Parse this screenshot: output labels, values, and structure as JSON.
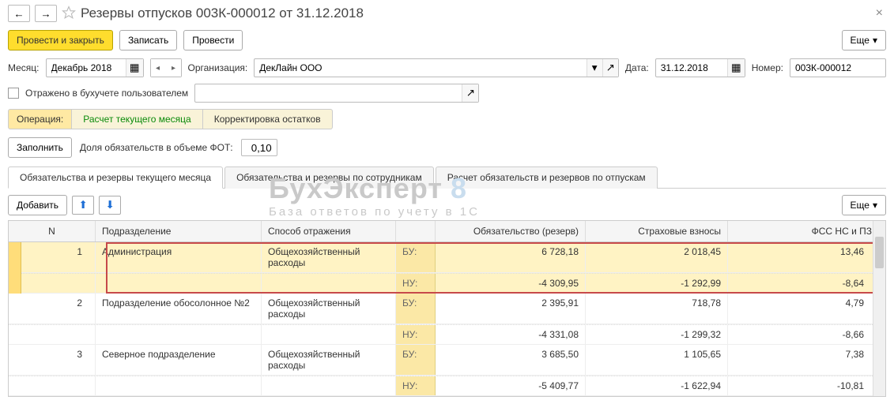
{
  "title": "Резервы отпусков  003К-000012 от 31.12.2018",
  "toolbar": {
    "post_and_close": "Провести и закрыть",
    "save": "Записать",
    "post": "Провести",
    "more": "Еще"
  },
  "fields": {
    "month_label": "Месяц:",
    "month_value": "Декабрь 2018",
    "org_label": "Организация:",
    "org_value": "ДекЛайн ООО",
    "date_label": "Дата:",
    "date_value": "31.12.2018",
    "number_label": "Номер:",
    "number_value": "003К-000012",
    "reflected_label": "Отражено в бухучете пользователем",
    "reflected_value": ""
  },
  "operation": {
    "label": "Операция:",
    "tabs": [
      "Расчет текущего месяца",
      "Корректировка остатков"
    ]
  },
  "fill": {
    "button": "Заполнить",
    "ratio_label": "Доля обязательств в объеме ФОТ:",
    "ratio_value": "0,10"
  },
  "main_tabs": [
    "Обязательства и резервы текущего месяца",
    "Обязательства и резервы по сотрудникам",
    "Расчет обязательств и резервов по отпускам"
  ],
  "table_toolbar": {
    "add": "Добавить",
    "more": "Еще"
  },
  "watermark": {
    "line1": "БухЭксперт",
    "badge": "8",
    "line2": "База ответов по учету в 1С"
  },
  "table": {
    "headers": {
      "n": "N",
      "pod": "Подразделение",
      "spos": "Способ отражения",
      "ob": "Обязательство (резерв)",
      "str": "Страховые взносы",
      "fss": "ФСС НС и ПЗ"
    },
    "rows": [
      {
        "n": "1",
        "pod": "Администрация",
        "spos": "Общехозяйственный расходы",
        "bu": {
          "acc": "БУ:",
          "ob": "6 728,18",
          "str": "2 018,45",
          "fss": "13,46"
        },
        "nu": {
          "acc": "НУ:",
          "ob": "-4 309,95",
          "str": "-1 292,99",
          "fss": "-8,64"
        }
      },
      {
        "n": "2",
        "pod": "Подразделение обосолонное №2",
        "spos": "Общехозяйственный расходы",
        "bu": {
          "acc": "БУ:",
          "ob": "2 395,91",
          "str": "718,78",
          "fss": "4,79"
        },
        "nu": {
          "acc": "НУ:",
          "ob": "-4 331,08",
          "str": "-1 299,32",
          "fss": "-8,66"
        }
      },
      {
        "n": "3",
        "pod": "Северное подразделение",
        "spos": "Общехозяйственный расходы",
        "bu": {
          "acc": "БУ:",
          "ob": "3 685,50",
          "str": "1 105,65",
          "fss": "7,38"
        },
        "nu": {
          "acc": "НУ:",
          "ob": "-5 409,77",
          "str": "-1 622,94",
          "fss": "-10,81"
        }
      }
    ]
  }
}
